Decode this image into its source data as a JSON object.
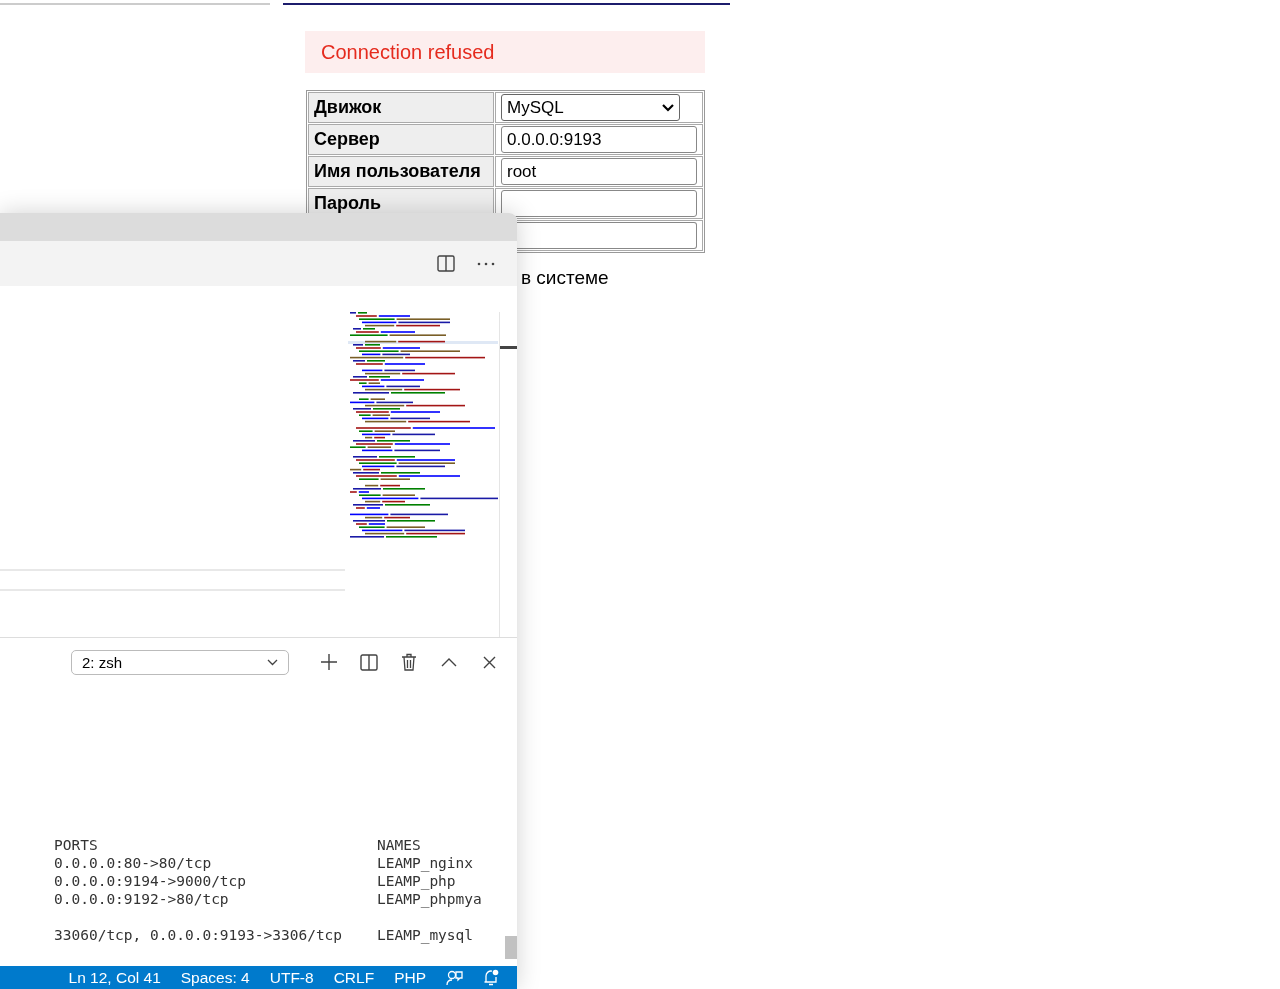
{
  "login_page": {
    "error": "Connection refused",
    "fields": [
      {
        "label": "Движок",
        "kind": "select",
        "value": "MySQL"
      },
      {
        "label": "Сервер",
        "kind": "text",
        "value": "0.0.0.0:9193"
      },
      {
        "label": "Имя пользователя",
        "kind": "text",
        "value": "root"
      },
      {
        "label": "Пароль",
        "kind": "password"
      },
      {
        "kind": "text"
      }
    ],
    "remember_label": "в системе"
  },
  "editor": {
    "terminal": {
      "selector": "2: zsh",
      "lines": [
        {
          "ports": "PORTS",
          "names": "NAMES"
        },
        {
          "ports": "0.0.0.0:80->80/tcp",
          "names": "LEAMP_nginx"
        },
        {
          "ports": "0.0.0.0:9194->9000/tcp",
          "names": "LEAMP_php"
        },
        {
          "ports": "0.0.0.0:9192->80/tcp",
          "names": "LEAMP_phpmya"
        },
        {
          "ports": "33060/tcp, 0.0.0.0:9193->3306/tcp",
          "names": "LEAMP_mysql",
          "gap_before": true
        }
      ]
    },
    "status_bar": [
      "Ln 12, Col 41",
      "Spaces: 4",
      "UTF-8",
      "CRLF",
      "PHP"
    ]
  }
}
